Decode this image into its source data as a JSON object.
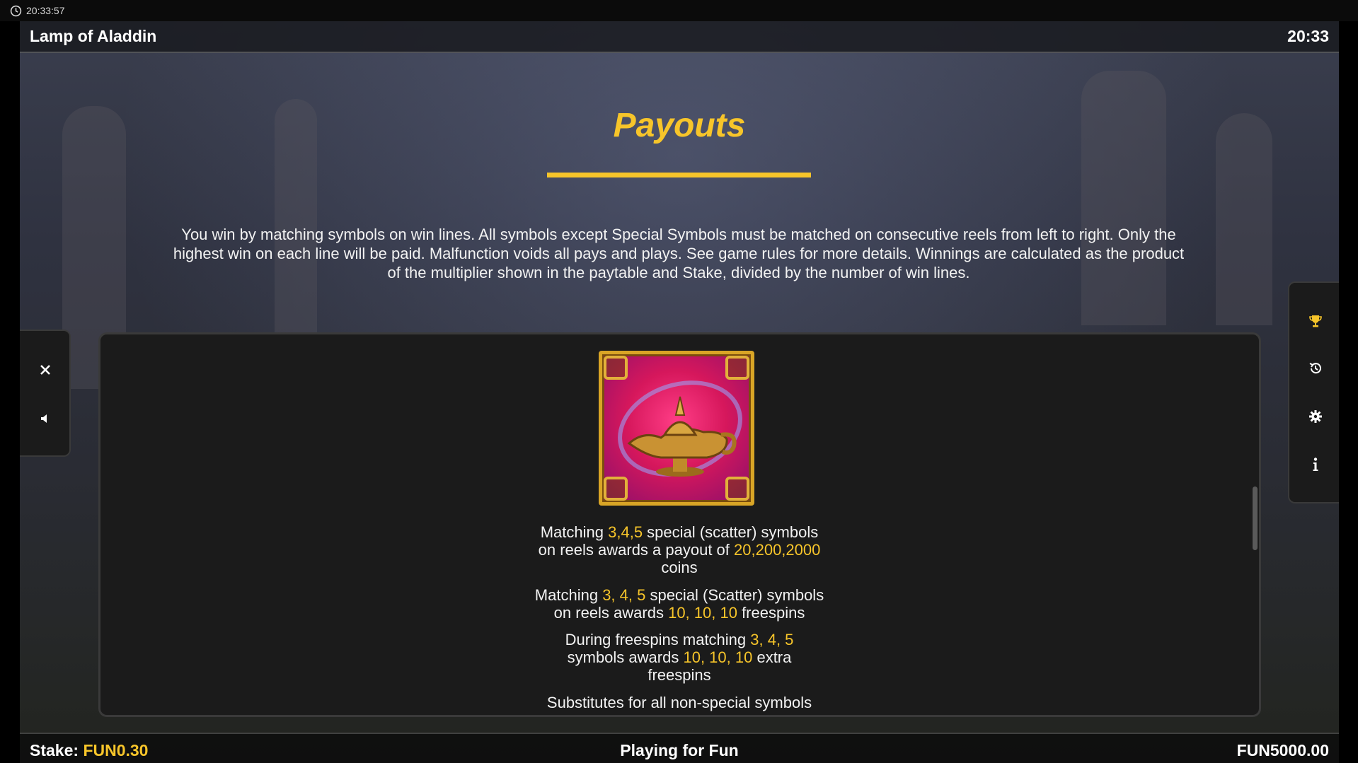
{
  "os_bar": {
    "time": "20:33:57",
    "icon": "clock-icon"
  },
  "header": {
    "game_title": "Lamp of Aladdin",
    "time": "20:33"
  },
  "page": {
    "title": "Payouts",
    "intro": "You win by matching symbols on win lines. All symbols except Special Symbols must be matched on consecutive reels from left to right. Only the highest win on each line will be paid. Malfunction voids all pays and plays. See game rules for more details. Winnings are calculated as the product of the multiplier shown in the paytable and Stake, divided by the number of win lines."
  },
  "symbol": {
    "name": "lamp-symbol",
    "icon": "magic-lamp-icon"
  },
  "rules": {
    "r1": {
      "a": "Matching ",
      "h1": "3,4,5",
      "b": " special (scatter) symbols",
      "c": "on reels awards a payout of ",
      "h2": "20,200,2000",
      "d": "coins"
    },
    "r2": {
      "a": "Matching ",
      "h1": "3, 4, 5",
      "b": " special (Scatter) symbols",
      "c": "on reels awards ",
      "h2": "10, 10, 10",
      "d": " freespins"
    },
    "r3": {
      "a": "During freespins matching ",
      "h1": "3, 4, 5",
      "b": "symbols awards ",
      "h2": "10, 10, 10",
      "c": " extra",
      "d": "freespins"
    },
    "r4": "Substitutes for all non-special symbols"
  },
  "side_left": {
    "close_icon": "close-icon",
    "sound_icon": "speaker-icon"
  },
  "side_right": {
    "icons": [
      "trophy-icon",
      "history-icon",
      "settings-icon",
      "info-icon"
    ]
  },
  "footer": {
    "stake_label": "Stake:",
    "stake_value": "FUN0.30",
    "mode": "Playing for Fun",
    "balance": "FUN5000.00"
  },
  "colors": {
    "accent": "#f7c52a",
    "panel": "#1b1b1b"
  }
}
